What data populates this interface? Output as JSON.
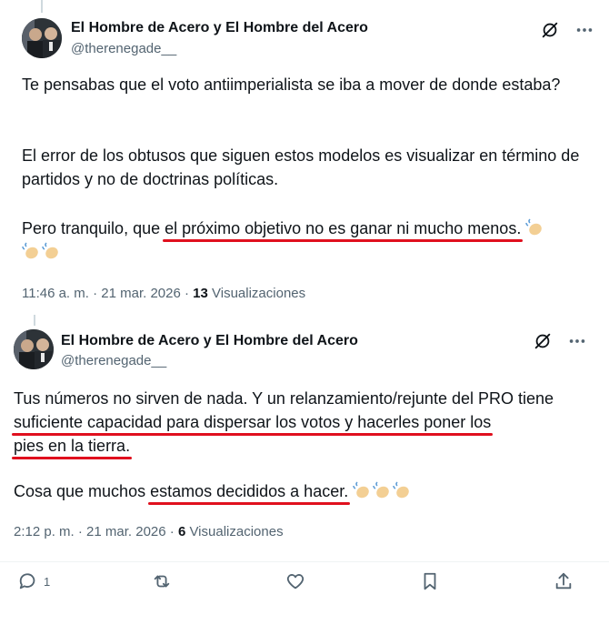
{
  "tweets": [
    {
      "author_name": "El Hombre de Acero y El Hombre del Acero",
      "handle": "@therenegade__",
      "p1": "Te pensabas que el voto antiimperialista se iba a mover de donde estaba?",
      "p2": "El error de los obtusos que siguen estos modelos es visualizar en término de partidos y no de doctrinas políticas.",
      "p3_pre": "Pero tranquilo, que ",
      "p3_underlined": "el próximo objetivo no es ganar ni mucho menos.",
      "time": "11:46 a. m. · 21 mar. 2026 · ",
      "views_count": "13",
      "views_label": " Visualizaciones"
    },
    {
      "author_name": "El Hombre de Acero y El Hombre del Acero",
      "handle": "@therenegade__",
      "p1_pre": "Tus números no sirven de nada. Y un relanzamiento/rejunte del PRO tiene ",
      "p1_u1": "suficiente capacidad para dispersar los votos y hacerles poner los",
      "p1_u2": "pies en la tierra.",
      "p2_pre": "Cosa que muchos ",
      "p2_underlined": "estamos decididos a hacer.",
      "time": "2:12 p. m. · 21 mar. 2026 · ",
      "views_count": "6",
      "views_label": " Visualizaciones"
    }
  ],
  "actions": {
    "reply_count": "1"
  },
  "icons": [
    "grok-icon",
    "more-icon",
    "reply-icon",
    "retweet-icon",
    "like-icon",
    "bookmark-icon",
    "share-icon",
    "clapping-hands-icon"
  ],
  "colors": {
    "underline": "#e0101e",
    "muted": "#536471",
    "text": "#0f1419"
  }
}
